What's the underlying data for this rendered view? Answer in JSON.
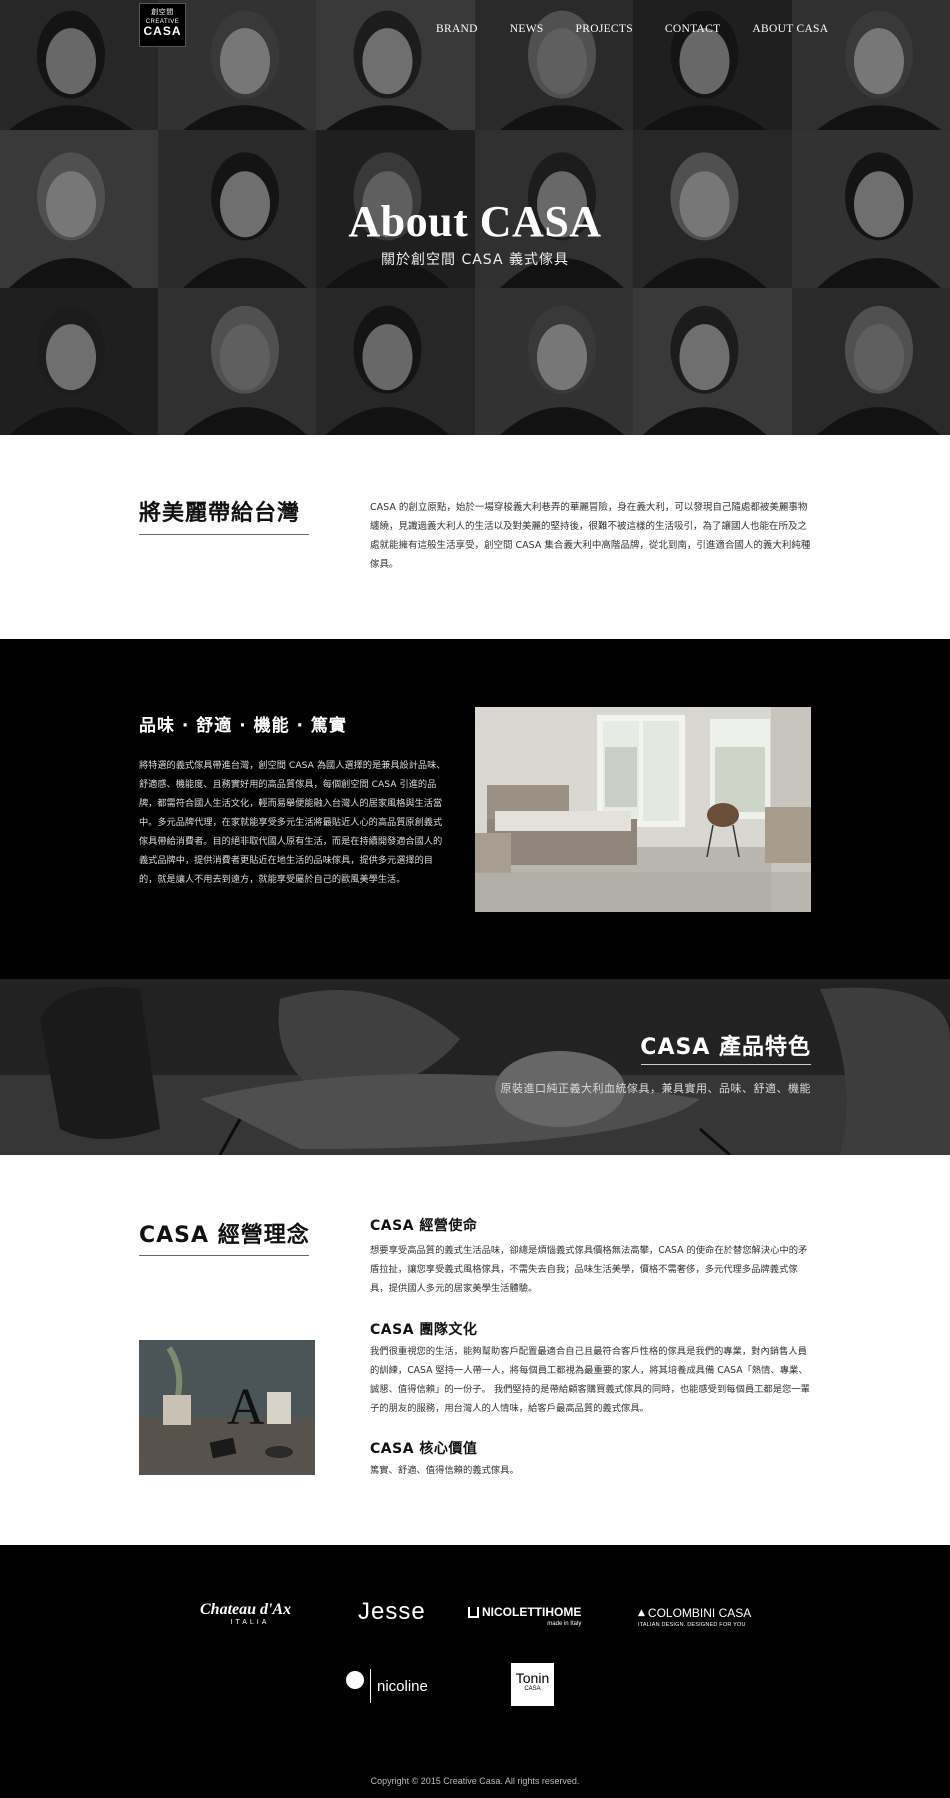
{
  "logo": {
    "line1": "創空間",
    "line2": "CREATIVE",
    "line3": "CASA"
  },
  "nav": {
    "items": [
      "BRAND",
      "NEWS",
      "PROJECTS",
      "CONTACT",
      "ABOUT CASA"
    ]
  },
  "hero": {
    "title": "About CASA",
    "subtitle": "關於創空間 CASA 義式傢具"
  },
  "intro": {
    "heading": "將美麗帶給台灣",
    "text": "CASA 的創立原點，始於一場穿梭義大利巷弄的華麗冒險，身在義大利，可以發現自己隨處都被美麗事物纏繞，見識過義大利人的生活以及對美麗的堅持後，很難不被這樣的生活吸引，為了讓國人也能在所及之處就能擁有這般生活享受，創空間 CASA 集合義大利中高階品牌，從北到南，引進適合國人的義大利純種傢具。"
  },
  "taste": {
    "heading": "品味 · 舒適 · 機能 · 篤實",
    "text": "將特選的義式傢具帶進台灣，創空間 CASA 為國人選擇的是兼具設計品味、舒適感、機能度、且務實好用的高品質傢具，每個創空間 CASA 引進的品牌，都需符合國人生活文化，輕而易舉便能融入台灣人的居家風格與生活當中。多元品牌代理，在家就能享受多元生活將最貼近人心的高品質原創義式傢具帶給消費者。目的絕非取代國人原有生活，而是在持續開發適合國人的義式品牌中，提供消費者更貼近在地生活的品味傢具，提供多元選擇的目的，就是讓人不用去到遠方，就能享受屬於自己的歐風美學生活。"
  },
  "features": {
    "heading": "CASA 產品特色",
    "text": "原裝進口純正義大利血統傢具，兼具實用、品味、舒適、機能"
  },
  "philosophy": {
    "heading": "CASA 經營理念",
    "mission_title": "CASA 經營使命",
    "mission_text": "想要享受高品質的義式生活品味，卻總是煩惱義式傢具價格無法高攀，CASA 的使命在於替您解決心中的矛盾拉扯，讓您享受義式風格傢具，不需失去自我；品味生活美學，價格不需奢侈，多元代理多品牌義式傢具，提供國人多元的居家美學生活體驗。",
    "team_title": "CASA 團隊文化",
    "team_text": "我們很重視您的生活，能夠幫助客戶配置最適合自己且最符合客戶性格的傢具是我們的專業，對內銷售人員的訓練，CASA 堅持一人帶一人，將每個員工都視為最重要的家人，將其培養成具備 CASA「熱情、專業、誠懇、值得信賴」的一份子。 我們堅持的是帶給顧客購買義式傢具的同時，也能感受到每個員工都是您一輩子的朋友的服務，用台灣人的人情味，給客戶最高品質的義式傢具。",
    "value_title": "CASA 核心價值",
    "value_text": "篤實、舒適、值得信賴的義式傢具。"
  },
  "brands": {
    "chateau": "Chateau d'Ax",
    "chateau_sub": "ITALIA",
    "jesse": "Jesse",
    "nicoletti": "NICOLETTIHOME",
    "nicoletti_sub": "made in Italy",
    "colombini": "COLOMBINI CASA",
    "colombini_sub": "ITALIAN DESIGN. DESIGNED FOR YOU",
    "nicoline": "nicoline",
    "tonin": "Tonin",
    "tonin_sub": "CASA"
  },
  "footer": {
    "copyright": "Copyright © 2015 Creative Casa. All rights reserved."
  },
  "colors": {
    "dark": "#000000",
    "text": "#333333",
    "accent": "#ffffff"
  }
}
